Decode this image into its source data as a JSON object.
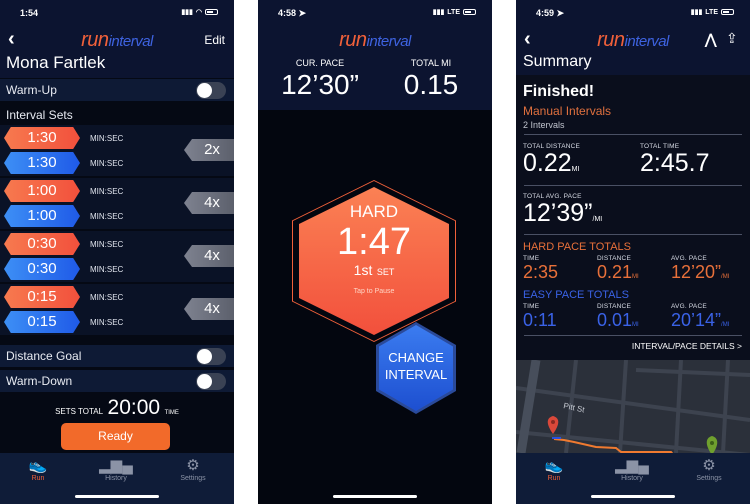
{
  "logo": {
    "run": "run",
    "interval": "interval"
  },
  "colors": {
    "hard": "#f2603a",
    "easy": "#2a6cf0",
    "background": "#050914",
    "accent": "#f26a2a"
  },
  "setup": {
    "status_time": "1:54",
    "back_icon": "chevron-left-icon",
    "edit_label": "Edit",
    "title": "Mona Fartlek",
    "warmup_label": "Warm-Up",
    "warmup_on": false,
    "interval_sets_label": "Interval Sets",
    "sets": [
      {
        "hard": "1:30",
        "easy": "1:30",
        "hard_unit": "MIN:SEC",
        "easy_unit": "MIN:SEC",
        "repeat": "2x"
      },
      {
        "hard": "1:00",
        "easy": "1:00",
        "hard_unit": "MIN:SEC",
        "easy_unit": "MIN:SEC",
        "repeat": "4x"
      },
      {
        "hard": "0:30",
        "easy": "0:30",
        "hard_unit": "MIN:SEC",
        "easy_unit": "MIN:SEC",
        "repeat": "4x"
      },
      {
        "hard": "0:15",
        "easy": "0:15",
        "hard_unit": "MIN:SEC",
        "easy_unit": "MIN:SEC",
        "repeat": "4x"
      }
    ],
    "distance_goal_label": "Distance Goal",
    "distance_goal_on": false,
    "warmdown_label": "Warm-Down",
    "warmdown_on": false,
    "sets_total_label": "SETS TOTAL",
    "sets_total_value": "20:00",
    "sets_total_unit": "TIME",
    "ready_label": "Ready"
  },
  "tabs": [
    {
      "label": "Run",
      "icon": "shoe-icon"
    },
    {
      "label": "History",
      "icon": "bar-chart-icon"
    },
    {
      "label": "Settings",
      "icon": "gear-icon"
    }
  ],
  "run": {
    "status_time": "4:58",
    "network": "LTE",
    "cur_pace_label": "CUR. PACE",
    "cur_pace_value": "12’30”",
    "total_mi_label": "TOTAL MI",
    "total_mi_value": "0.15",
    "interval_type": "HARD",
    "timer": "1:47",
    "set_number": "1st",
    "set_label": "SET",
    "hint": "Tap to Pause",
    "change_line1": "CHANGE",
    "change_line2": "INTERVAL"
  },
  "summary": {
    "status_time": "4:59",
    "network": "LTE",
    "title": "Summary",
    "finished": "Finished!",
    "mode": "Manual Intervals",
    "intervals": "2 Intervals",
    "total_distance_label": "TOTAL DISTANCE",
    "total_distance_value": "0.22",
    "total_distance_unit": "MI",
    "total_time_label": "TOTAL TIME",
    "total_time_value": "2:45.7",
    "avg_pace_label": "TOTAL AVG. PACE",
    "avg_pace_value": "12’39”",
    "avg_pace_unit": "/MI",
    "hard": {
      "title": "HARD PACE TOTALS",
      "time_label": "TIME",
      "time": "2:35",
      "distance_label": "DISTANCE",
      "distance": "0.21",
      "distance_unit": "MI",
      "pace_label": "AVG. PACE",
      "pace": "12’20”",
      "pace_unit": "/MI"
    },
    "easy": {
      "title": "EASY PACE TOTALS",
      "time_label": "TIME",
      "time": "0:11",
      "distance_label": "DISTANCE",
      "distance": "0.01",
      "distance_unit": "MI",
      "pace_label": "AVG. PACE",
      "pace": "20’14”",
      "pace_unit": "/MI"
    },
    "details_link": "INTERVAL/PACE DETAILS >",
    "map_street": "Pitt St"
  }
}
